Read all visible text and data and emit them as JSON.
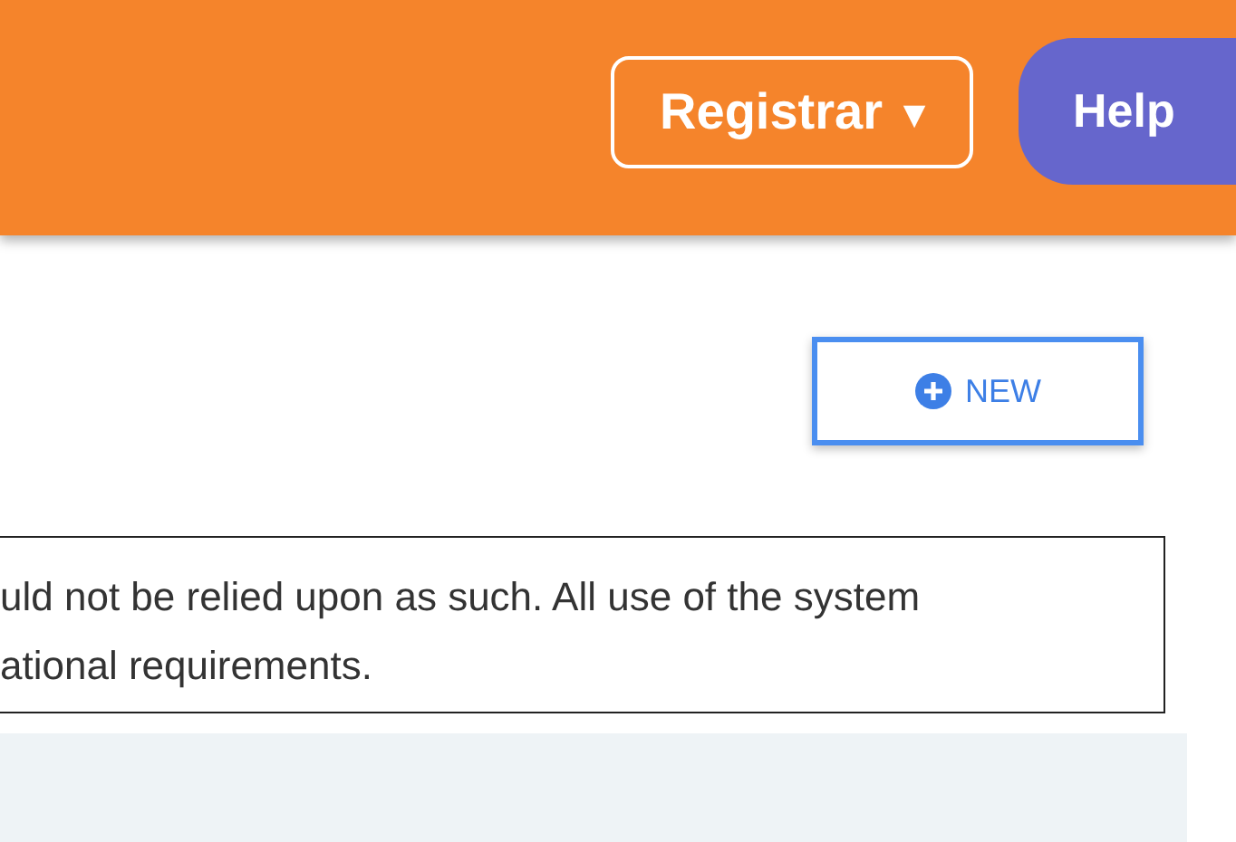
{
  "header": {
    "menu": {
      "label": "Registrar",
      "caret": "▾"
    },
    "help": {
      "label": "Help"
    }
  },
  "new_button": {
    "label": "NEW"
  },
  "notice": {
    "lines": [
      "uld not be relied upon as such. All use of the system",
      "ational requirements."
    ]
  }
}
